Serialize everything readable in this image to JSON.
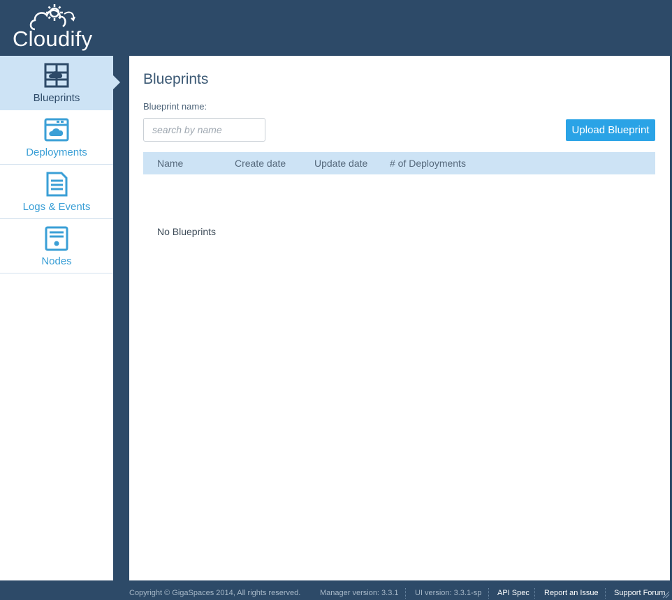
{
  "app": {
    "logo_text": "Cloudify"
  },
  "sidebar": {
    "items": [
      {
        "label": "Blueprints",
        "icon": "blueprints-icon",
        "active": true
      },
      {
        "label": "Deployments",
        "icon": "deployments-icon",
        "active": false
      },
      {
        "label": "Logs & Events",
        "icon": "logs-events-icon",
        "active": false
      },
      {
        "label": "Nodes",
        "icon": "nodes-icon",
        "active": false
      }
    ]
  },
  "main": {
    "title": "Blueprints",
    "search": {
      "label": "Blueprint name:",
      "placeholder": "search by name",
      "value": ""
    },
    "upload_button": "Upload Blueprint",
    "table": {
      "columns": [
        "Name",
        "Create date",
        "Update date",
        "# of Deployments"
      ],
      "rows": [],
      "empty_message": "No Blueprints"
    }
  },
  "footer": {
    "copyright": "Copyright © GigaSpaces 2014, All rights reserved.",
    "manager_version": "Manager version: 3.3.1",
    "ui_version": "UI version: 3.3.1-sp",
    "links": [
      "API Spec",
      "Report an Issue",
      "Support Forum"
    ]
  },
  "colors": {
    "frame": "#2d4a68",
    "accent": "#2aa3e6",
    "active_nav": "#cde3f5",
    "nav_text": "#3a9fd6"
  }
}
